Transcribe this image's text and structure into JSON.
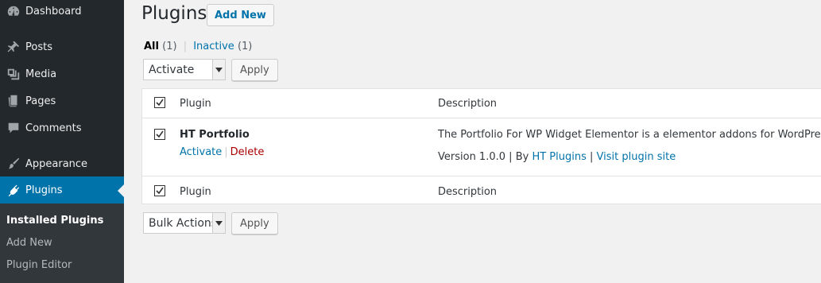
{
  "sidebar": {
    "items": [
      {
        "label": "Dashboard",
        "icon": "dashboard-icon"
      },
      {
        "label": "Posts",
        "icon": "pin-icon"
      },
      {
        "label": "Media",
        "icon": "media-icon"
      },
      {
        "label": "Pages",
        "icon": "pages-icon"
      },
      {
        "label": "Comments",
        "icon": "comment-icon"
      },
      {
        "label": "Appearance",
        "icon": "brush-icon"
      },
      {
        "label": "Plugins",
        "icon": "plug-icon",
        "active": true
      }
    ],
    "submenu": [
      {
        "label": "Installed Plugins",
        "current": true
      },
      {
        "label": "Add New"
      },
      {
        "label": "Plugin Editor"
      }
    ]
  },
  "header": {
    "title": "Plugins",
    "add_new_label": "Add New"
  },
  "filters": {
    "all_label": "All",
    "all_count": "(1)",
    "separator": "|",
    "inactive_label": "Inactive",
    "inactive_count": "(1)"
  },
  "top_actions": {
    "select_value": "Activate",
    "apply_label": "Apply"
  },
  "bottom_actions": {
    "select_value": "Bulk Actions",
    "apply_label": "Apply"
  },
  "table": {
    "columns": [
      "Plugin",
      "Description"
    ],
    "rows": [
      {
        "name": "HT Portfolio",
        "actions": [
          "Activate",
          "Delete"
        ],
        "action_sep": "|",
        "description": "The Portfolio For WP Widget Elementor is a elementor addons for WordPress.",
        "version_text": "Version 1.0.0",
        "sep1": "|",
        "by_text": "By",
        "author_link": "HT Plugins",
        "sep2": "|",
        "site_link": "Visit plugin site"
      }
    ]
  },
  "colors": {
    "sidebar_bg": "#23282d",
    "active_bg": "#0073aa",
    "link": "#0073aa",
    "delete": "#aa0000"
  }
}
